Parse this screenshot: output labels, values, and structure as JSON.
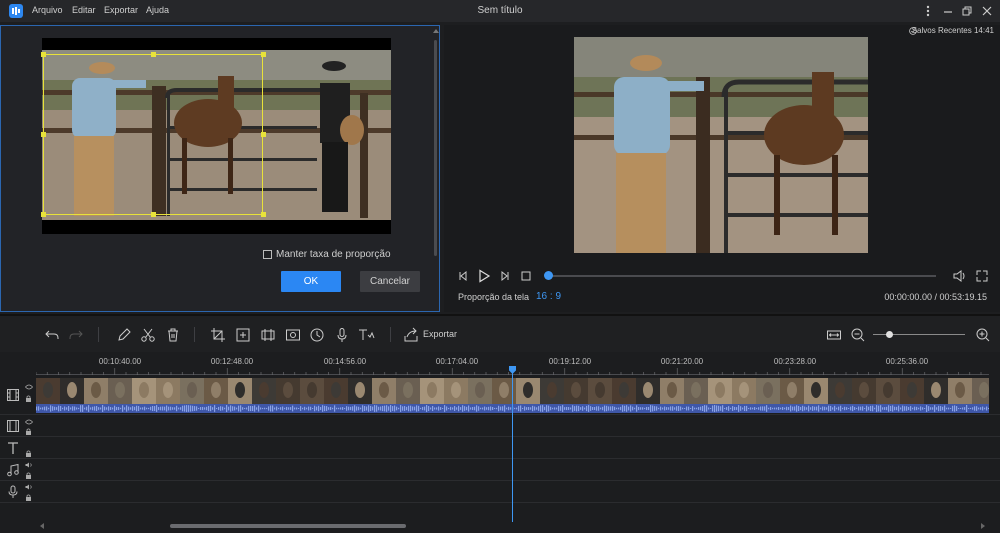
{
  "app": {
    "title": "Sem título",
    "menu": [
      "Arquivo",
      "Editar",
      "Exportar",
      "Ajuda"
    ]
  },
  "crop_panel": {
    "ratio_label": "Manter taxa de proporção",
    "ok_label": "OK",
    "cancel_label": "Cancelar"
  },
  "preview": {
    "saved_label": "Salvos Recentes 14:41",
    "ratio_text": "Proporção da tela",
    "ratio_value": "16 : 9",
    "time_text": "00:00:00.00 / 00:53:19.15",
    "progress": 0.0
  },
  "toolbar": {
    "export_label": "Exportar",
    "zoom_level": 0.15
  },
  "timeline": {
    "ticks": [
      "00:10:40.00",
      "00:12:48.00",
      "00:14:56.00",
      "00:17:04.00",
      "00:19:12.00",
      "00:21:20.00",
      "00:23:28.00",
      "00:25:36.00"
    ],
    "tracks": [
      "video-track",
      "overlay-track",
      "text-track",
      "music-track",
      "voice-track"
    ]
  },
  "colors": {
    "accent": "#2b87f3",
    "crop_handle": "#e8e23a",
    "audio_wave": "#3f57a8"
  }
}
